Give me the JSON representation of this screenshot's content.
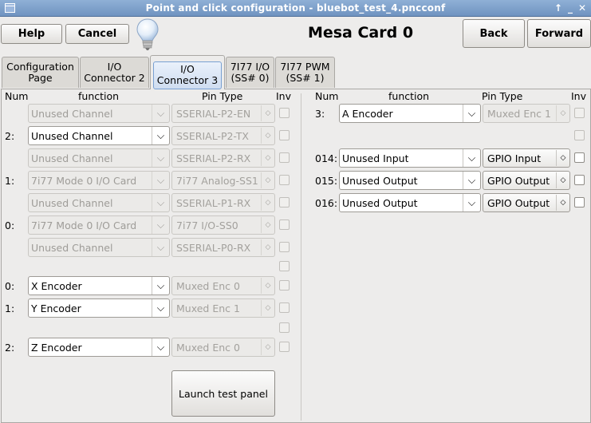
{
  "window": {
    "title": "Point and click configuration - bluebot_test_4.pncconf",
    "controls": [
      "↑",
      "_",
      "✕"
    ]
  },
  "toolbar": {
    "help": "Help",
    "cancel": "Cancel",
    "back": "Back",
    "forward": "Forward"
  },
  "card_title": "Mesa Card 0",
  "tabs": [
    {
      "l1": "Configuration",
      "l2": "Page"
    },
    {
      "l1": "I/O",
      "l2": "Connector 2"
    },
    {
      "l1": "I/O",
      "l2": "Connector 3"
    },
    {
      "l1": "7I77 I/O",
      "l2": "(SS# 0)"
    },
    {
      "l1": "7I77 PWM",
      "l2": "(SS# 1)"
    }
  ],
  "headers": {
    "num": "Num",
    "function": "function",
    "pin_type": "Pin Type",
    "inv": "Inv"
  },
  "left_rows": [
    {
      "num": "",
      "function": "Unused Channel",
      "fn_enabled": false,
      "pin": "SSERIAL-P2-EN",
      "pin_enabled": false,
      "inv_enabled": false
    },
    {
      "num": "2:",
      "function": "Unused Channel",
      "fn_enabled": true,
      "pin": "SSERIAL-P2-TX",
      "pin_enabled": false,
      "inv_enabled": false
    },
    {
      "num": "",
      "function": "Unused Channel",
      "fn_enabled": false,
      "pin": "SSERIAL-P2-RX",
      "pin_enabled": false,
      "inv_enabled": false
    },
    {
      "num": "1:",
      "function": "7i77 Mode 0 I/O Card",
      "fn_enabled": false,
      "pin": "7i77 Analog-SS1",
      "pin_enabled": false,
      "inv_enabled": false
    },
    {
      "num": "",
      "function": "Unused Channel",
      "fn_enabled": false,
      "pin": "SSERIAL-P1-RX",
      "pin_enabled": false,
      "inv_enabled": false
    },
    {
      "num": "0:",
      "function": "7i77 Mode 0 I/O Card",
      "fn_enabled": false,
      "pin": "7i77 I/O-SS0",
      "pin_enabled": false,
      "inv_enabled": false
    },
    {
      "num": "",
      "function": "Unused Channel",
      "fn_enabled": false,
      "pin": "SSERIAL-P0-RX",
      "pin_enabled": false,
      "inv_enabled": false
    },
    {
      "num": "0:",
      "function": "X Encoder",
      "fn_enabled": true,
      "pin": "Muxed Enc 0",
      "pin_enabled": false,
      "inv_enabled": false
    },
    {
      "num": "1:",
      "function": "Y Encoder",
      "fn_enabled": true,
      "pin": "Muxed Enc 1",
      "pin_enabled": false,
      "inv_enabled": false
    },
    {
      "num": "2:",
      "function": "Z Encoder",
      "fn_enabled": true,
      "pin": "Muxed Enc 0",
      "pin_enabled": false,
      "inv_enabled": false
    }
  ],
  "right_rows": [
    {
      "num": "3:",
      "function": "A Encoder",
      "fn_enabled": true,
      "pin": "Muxed Enc 1",
      "pin_enabled": false,
      "inv_enabled": false
    },
    {
      "num": "014:",
      "function": "Unused Input",
      "fn_enabled": true,
      "pin": "GPIO Input",
      "pin_enabled": true,
      "inv_enabled": true
    },
    {
      "num": "015:",
      "function": "Unused Output",
      "fn_enabled": true,
      "pin": "GPIO Output",
      "pin_enabled": true,
      "inv_enabled": true
    },
    {
      "num": "016:",
      "function": "Unused Output",
      "fn_enabled": true,
      "pin": "GPIO Output",
      "pin_enabled": true,
      "inv_enabled": true
    }
  ],
  "launch_test_panel": "Launch test panel"
}
